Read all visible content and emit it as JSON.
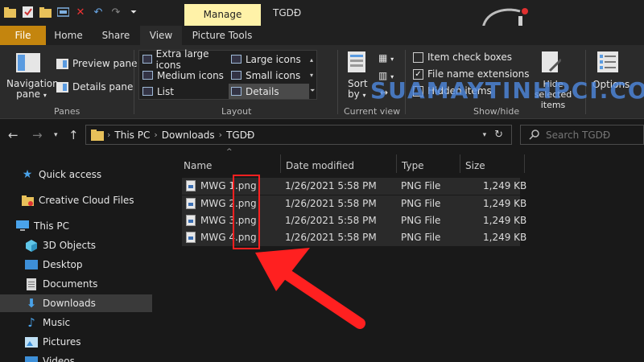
{
  "window": {
    "context_tab": "Manage",
    "title": "TGDĐ"
  },
  "ribbon_tabs": {
    "file": "File",
    "home": "Home",
    "share": "Share",
    "view": "View",
    "picture_tools": "Picture Tools"
  },
  "ribbon": {
    "panes": {
      "navigation_pane": "Navigation pane",
      "preview_pane": "Preview pane",
      "details_pane": "Details pane",
      "label": "Panes"
    },
    "layout": {
      "extra_large_icons": "Extra large icons",
      "large_icons": "Large icons",
      "medium_icons": "Medium icons",
      "small_icons": "Small icons",
      "list": "List",
      "details": "Details",
      "label": "Layout",
      "selected": "Details"
    },
    "current_view": {
      "sort_by": "Sort by",
      "label": "Current view"
    },
    "show_hide": {
      "item_check_boxes": "Item check boxes",
      "item_check_boxes_checked": false,
      "file_name_extensions": "File name extensions",
      "file_name_extensions_checked": true,
      "hidden_items": "Hidden items",
      "hidden_items_checked": false,
      "hide_selected_items": "Hide selected items",
      "label": "Show/hide"
    },
    "options": "Options"
  },
  "address": {
    "crumbs": [
      "This PC",
      "Downloads",
      "TGDĐ"
    ],
    "search_placeholder": "Search TGDĐ"
  },
  "sidebar": {
    "items": [
      {
        "label": "Quick access",
        "icon": "star-icon"
      },
      {
        "label": "Creative Cloud Files",
        "icon": "creative-cloud-icon"
      },
      {
        "label": "This PC",
        "icon": "computer-icon"
      },
      {
        "label": "3D Objects",
        "icon": "cube-icon"
      },
      {
        "label": "Desktop",
        "icon": "desktop-icon"
      },
      {
        "label": "Documents",
        "icon": "document-icon"
      },
      {
        "label": "Downloads",
        "icon": "download-icon"
      },
      {
        "label": "Music",
        "icon": "music-icon"
      },
      {
        "label": "Pictures",
        "icon": "picture-icon"
      },
      {
        "label": "Videos",
        "icon": "video-icon"
      }
    ],
    "selected": "Downloads"
  },
  "file_list": {
    "columns": [
      "Name",
      "Date modified",
      "Type",
      "Size"
    ],
    "rows": [
      {
        "name": "MWG 1.png",
        "date": "1/26/2021 5:58 PM",
        "type": "PNG File",
        "size": "1,249 KB"
      },
      {
        "name": "MWG 2.png",
        "date": "1/26/2021 5:58 PM",
        "type": "PNG File",
        "size": "1,249 KB"
      },
      {
        "name": "MWG 3.png",
        "date": "1/26/2021 5:58 PM",
        "type": "PNG File",
        "size": "1,249 KB"
      },
      {
        "name": "MWG 4.png",
        "date": "1/26/2021 5:58 PM",
        "type": "PNG File",
        "size": "1,249 KB"
      }
    ]
  },
  "watermark": {
    "text": "SUAMAYTINHPCI.COM",
    "logo": "pci"
  },
  "colors": {
    "file_tab": "#c4850e",
    "context_tab": "#fff2a8",
    "annotation": "#ff2020",
    "watermark": "#508ce6"
  }
}
